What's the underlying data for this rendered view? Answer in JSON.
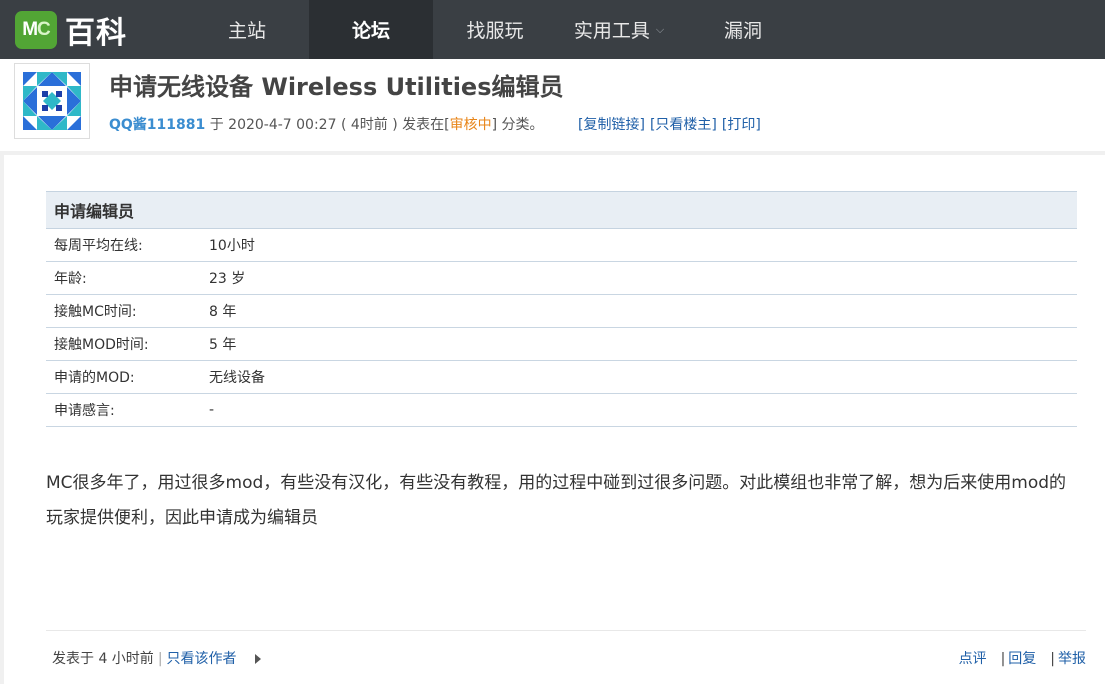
{
  "logo": {
    "mc_m": "M",
    "mc_c": "C",
    "text": "百科"
  },
  "nav": {
    "items": [
      "主站",
      "论坛",
      "找服玩",
      "实用工具",
      "漏洞"
    ],
    "active_index": 1,
    "dropdown_caret": "⌵"
  },
  "thread": {
    "title": "申请无线设备 Wireless Utilities编辑员",
    "author": "QQ酱111881",
    "posted_prefix": "于",
    "date": "2020-4-7 00:27",
    "relative_time": "( 4时前 )",
    "posted_in": "发表在",
    "category_open": "[",
    "category": "审核中",
    "category_close": "]",
    "category_suffix": "分类。",
    "links": [
      "[复制链接]",
      "[只看楼主]",
      "[打印]"
    ]
  },
  "application": {
    "header": "申请编辑员",
    "rows": [
      {
        "key": "每周平均在线:",
        "value": "10小时"
      },
      {
        "key": "年龄:",
        "value": "23 岁"
      },
      {
        "key": "接触MC时间:",
        "value": "8 年"
      },
      {
        "key": "接触MOD时间:",
        "value": "5 年"
      },
      {
        "key": "申请的MOD:",
        "value": "无线设备"
      },
      {
        "key": "申请感言:",
        "value": "-"
      }
    ]
  },
  "body": "MC很多年了，用过很多mod，有些没有汉化，有些没有教程，用的过程中碰到过很多问题。对此模组也非常了解，想为后来使用mod的玩家提供便利，因此申请成为编辑员",
  "footer": {
    "posted": "发表于 4 小时前",
    "sep": "|",
    "author_only": "只看该作者",
    "actions": [
      "点评",
      "回复",
      "举报"
    ]
  },
  "colors": {
    "topbar": "#3a3f44",
    "accent_link": "#2060a8",
    "status": "#e8861a",
    "author": "#3b8dd0"
  }
}
